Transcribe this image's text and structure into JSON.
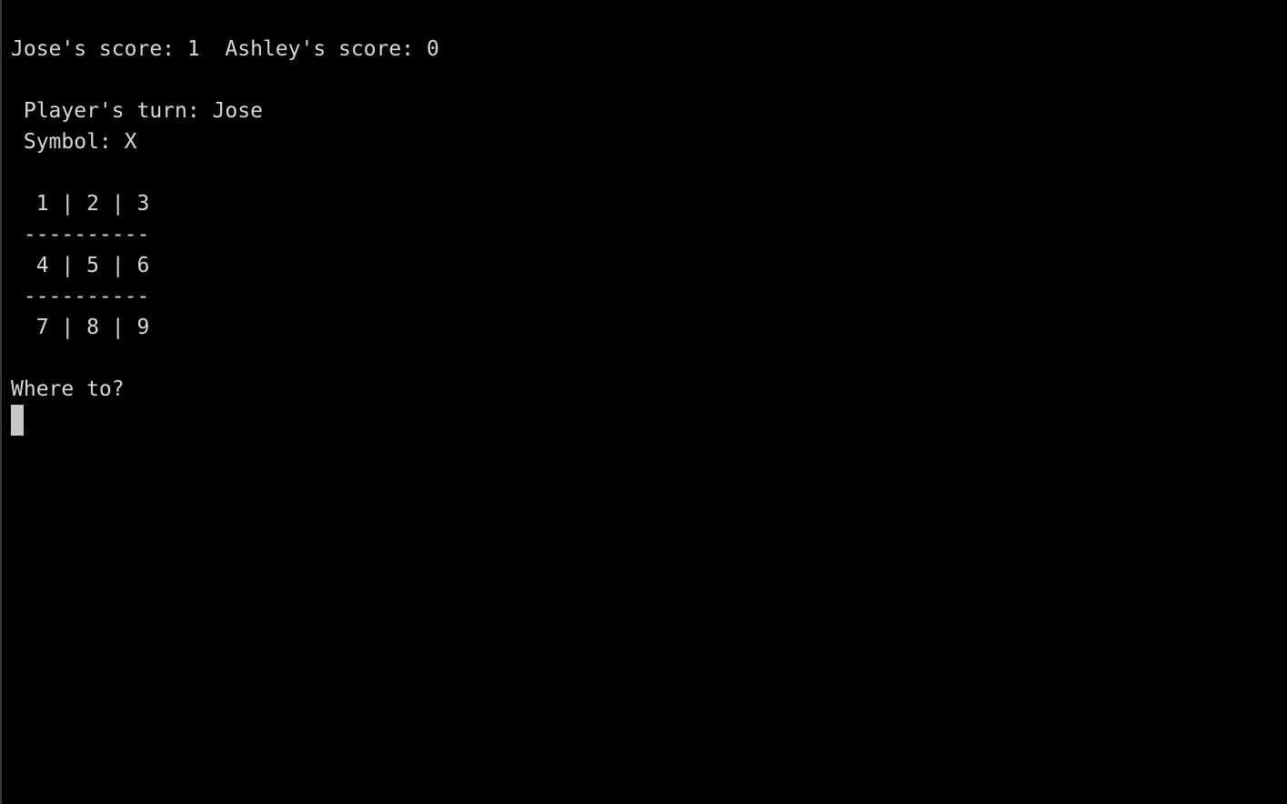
{
  "colors": {
    "background": "#000000",
    "text": "#d8d8d8",
    "cursor": "#c8c8c8"
  },
  "terminal": {
    "score_line": "Jose's score: 1  Ashley's score: 0",
    "turn_line": " Player's turn: Jose",
    "symbol_line": " Symbol: X",
    "board": {
      "row_1": "  1 | 2 | 3",
      "divider_1": " ----------",
      "row_2": "  4 | 5 | 6",
      "divider_2": " ----------",
      "row_3": "  7 | 8 | 9"
    },
    "prompt": "Where to?"
  }
}
